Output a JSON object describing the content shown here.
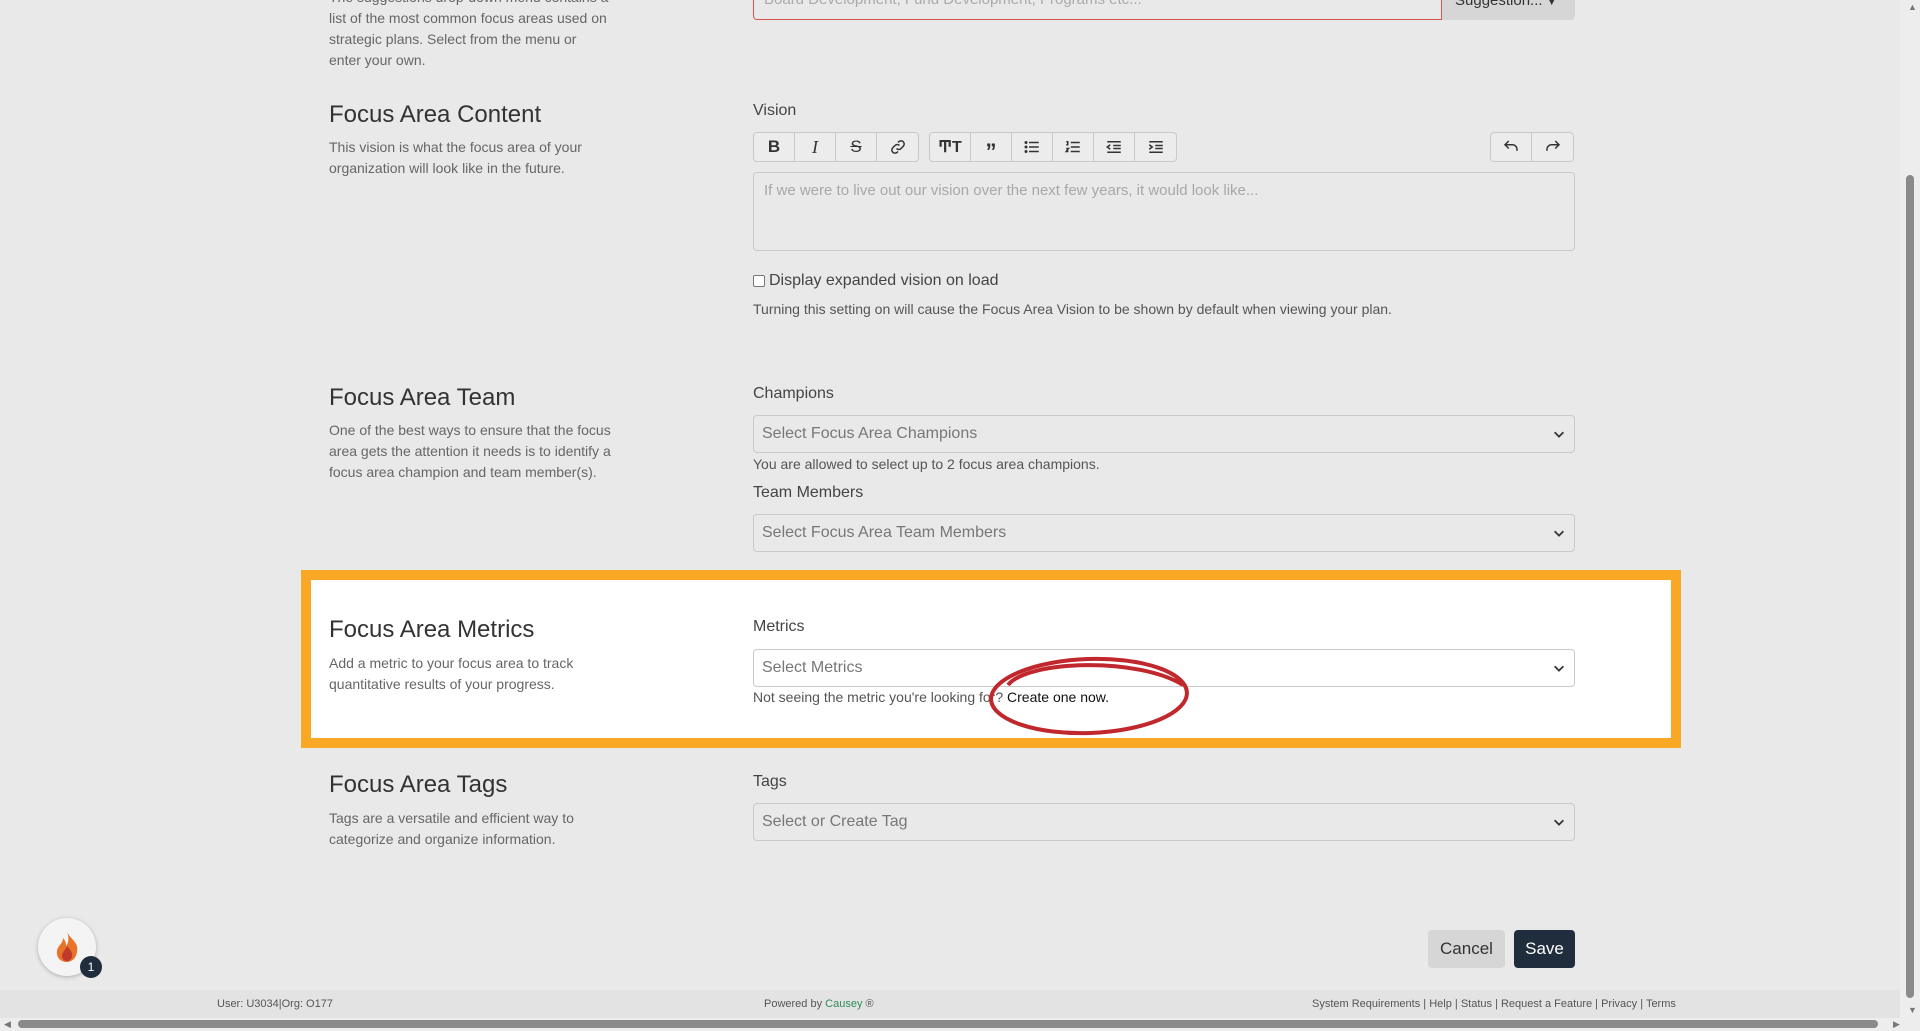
{
  "top_field": {
    "description_partial": "The suggestions drop-down menu contains a",
    "description_lines": [
      "list of the most common focus areas used on",
      "strategic plans. Select from the menu or",
      "enter your own."
    ],
    "placeholder": "Board Development, Fund Development, Programs etc...",
    "suggestion_label": "Suggestion..."
  },
  "content_section": {
    "title": "Focus Area Content",
    "description": "This vision is what the focus area of your organization will look like in the future.",
    "field_label": "Vision",
    "editor_placeholder": "If we were to live out our vision over the next few years, it would look like...",
    "checkbox_label": "Display expanded vision on load",
    "help_text": "Turning this setting on will cause the Focus Area Vision to be shown by default when viewing your plan."
  },
  "team_section": {
    "title": "Focus Area Team",
    "description": "One of the best ways to ensure that the focus area gets the attention it needs is to identify a focus area champion and team member(s).",
    "champions_label": "Champions",
    "champions_placeholder": "Select Focus Area Champions",
    "champions_help": "You are allowed to select up to 2 focus area champions.",
    "members_label": "Team Members",
    "members_placeholder": "Select Focus Area Team Members"
  },
  "metrics_section": {
    "title": "Focus Area Metrics",
    "description": "Add a metric to your focus area to track quantitative results of your progress.",
    "field_label": "Metrics",
    "placeholder": "Select Metrics",
    "help_prefix": "Not seeing the metric you're looking for?",
    "help_link": "Create one now."
  },
  "tags_section": {
    "title": "Focus Area Tags",
    "description": "Tags are a versatile and efficient way to categorize and organize information.",
    "field_label": "Tags",
    "placeholder": "Select or Create Tag"
  },
  "actions": {
    "cancel": "Cancel",
    "save": "Save"
  },
  "fab": {
    "icon": "flame-icon",
    "badge": "1"
  },
  "footer": {
    "user_info": "User: U3034|Org: O177",
    "powered_by": "Powered by",
    "brand": "Causey",
    "registered": "®",
    "links": [
      "System Requirements",
      "Help",
      "Status",
      "Request a Feature",
      "Privacy",
      "Terms"
    ]
  },
  "colors": {
    "highlight": "#f9a825",
    "annotation_ring": "#c0282d",
    "brand": "#2e8b57",
    "save_button": "#1f2d3d"
  }
}
